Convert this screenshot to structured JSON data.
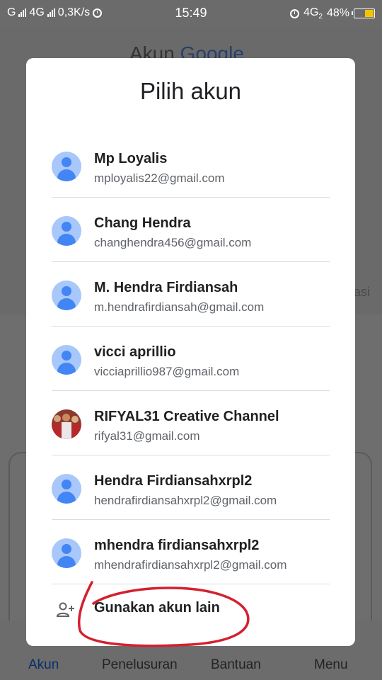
{
  "status_bar": {
    "carrier_left": "G",
    "network_left": "4G",
    "speed": "0,3K/s",
    "time": "15:49",
    "network_right": "4G",
    "network_right_sub": "2",
    "battery": "48%",
    "battery_level": 0.48
  },
  "background": {
    "logo_prefix": "Akun ",
    "logo_brand": "Google",
    "side_text": "asi",
    "nav": [
      {
        "label": "Akun"
      },
      {
        "label": "Penelusuran"
      },
      {
        "label": "Bantuan"
      },
      {
        "label": "Menu"
      }
    ]
  },
  "dialog": {
    "title": "Pilih akun",
    "accounts": [
      {
        "name": "Mp Loyalis",
        "email": "mployalis22@gmail.com",
        "avatar": "default-avatar-icon"
      },
      {
        "name": "Chang Hendra",
        "email": "changhendra456@gmail.com",
        "avatar": "default-avatar-icon"
      },
      {
        "name": "M. Hendra Firdiansah",
        "email": "m.hendrafirdiansah@gmail.com",
        "avatar": "default-avatar-icon"
      },
      {
        "name": "vicci aprillio",
        "email": "vicciaprillio987@gmail.com",
        "avatar": "default-avatar-icon"
      },
      {
        "name": "RIFYAL31 Creative Channel",
        "email": "rifyal31@gmail.com",
        "avatar": "photo-avatar"
      },
      {
        "name": "Hendra Firdiansahxrpl2",
        "email": "hendrafirdiansahxrpl2@gmail.com",
        "avatar": "default-avatar-icon"
      },
      {
        "name": "mhendra firdiansahxrpl2",
        "email": "mhendrafirdiansahxrpl2@gmail.com",
        "avatar": "default-avatar-icon"
      }
    ],
    "use_other_label": "Gunakan akun lain",
    "use_other_icon": "add-person-icon"
  },
  "colors": {
    "avatar_bg": "#a8c7fa",
    "avatar_fg": "#4285f4",
    "annotation": "#d3202f",
    "battery_fill": "#f5c400"
  }
}
